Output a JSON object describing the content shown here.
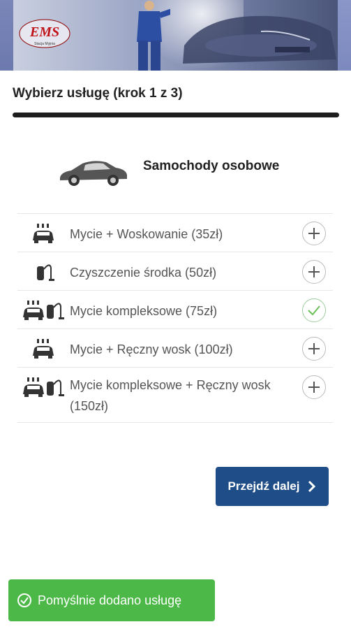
{
  "header": {
    "logo_text": "EMS",
    "logo_subtext": "Stacja Myjnia"
  },
  "step": {
    "title": "Wybierz usługę (krok 1 z 3)",
    "progress": 1.0
  },
  "category": {
    "label": "Samochody osobowe",
    "icon": "car-icon"
  },
  "services": [
    {
      "label": "Mycie + Woskowanie (35zł)",
      "icon": "car-wash-icon",
      "selected": false
    },
    {
      "label": "Czyszczenie środka (50zł)",
      "icon": "vacuum-icon",
      "selected": false
    },
    {
      "label": "Mycie kompleksowe (75zł)",
      "icon": "car-wash-vacuum-icon",
      "selected": true
    },
    {
      "label": "Mycie + Ręczny wosk (100zł)",
      "icon": "car-wash-icon",
      "selected": false
    },
    {
      "label": "Mycie kompleksowe + Ręczny wosk (150zł)",
      "icon": "car-wash-vacuum-icon",
      "selected": false
    }
  ],
  "next_button": {
    "label": "Przejdź dalej"
  },
  "toast": {
    "label": "Pomyślnie dodano usługę"
  },
  "colors": {
    "primary": "#1f4d87",
    "success": "#4cb847",
    "check": "#6bbf59"
  }
}
